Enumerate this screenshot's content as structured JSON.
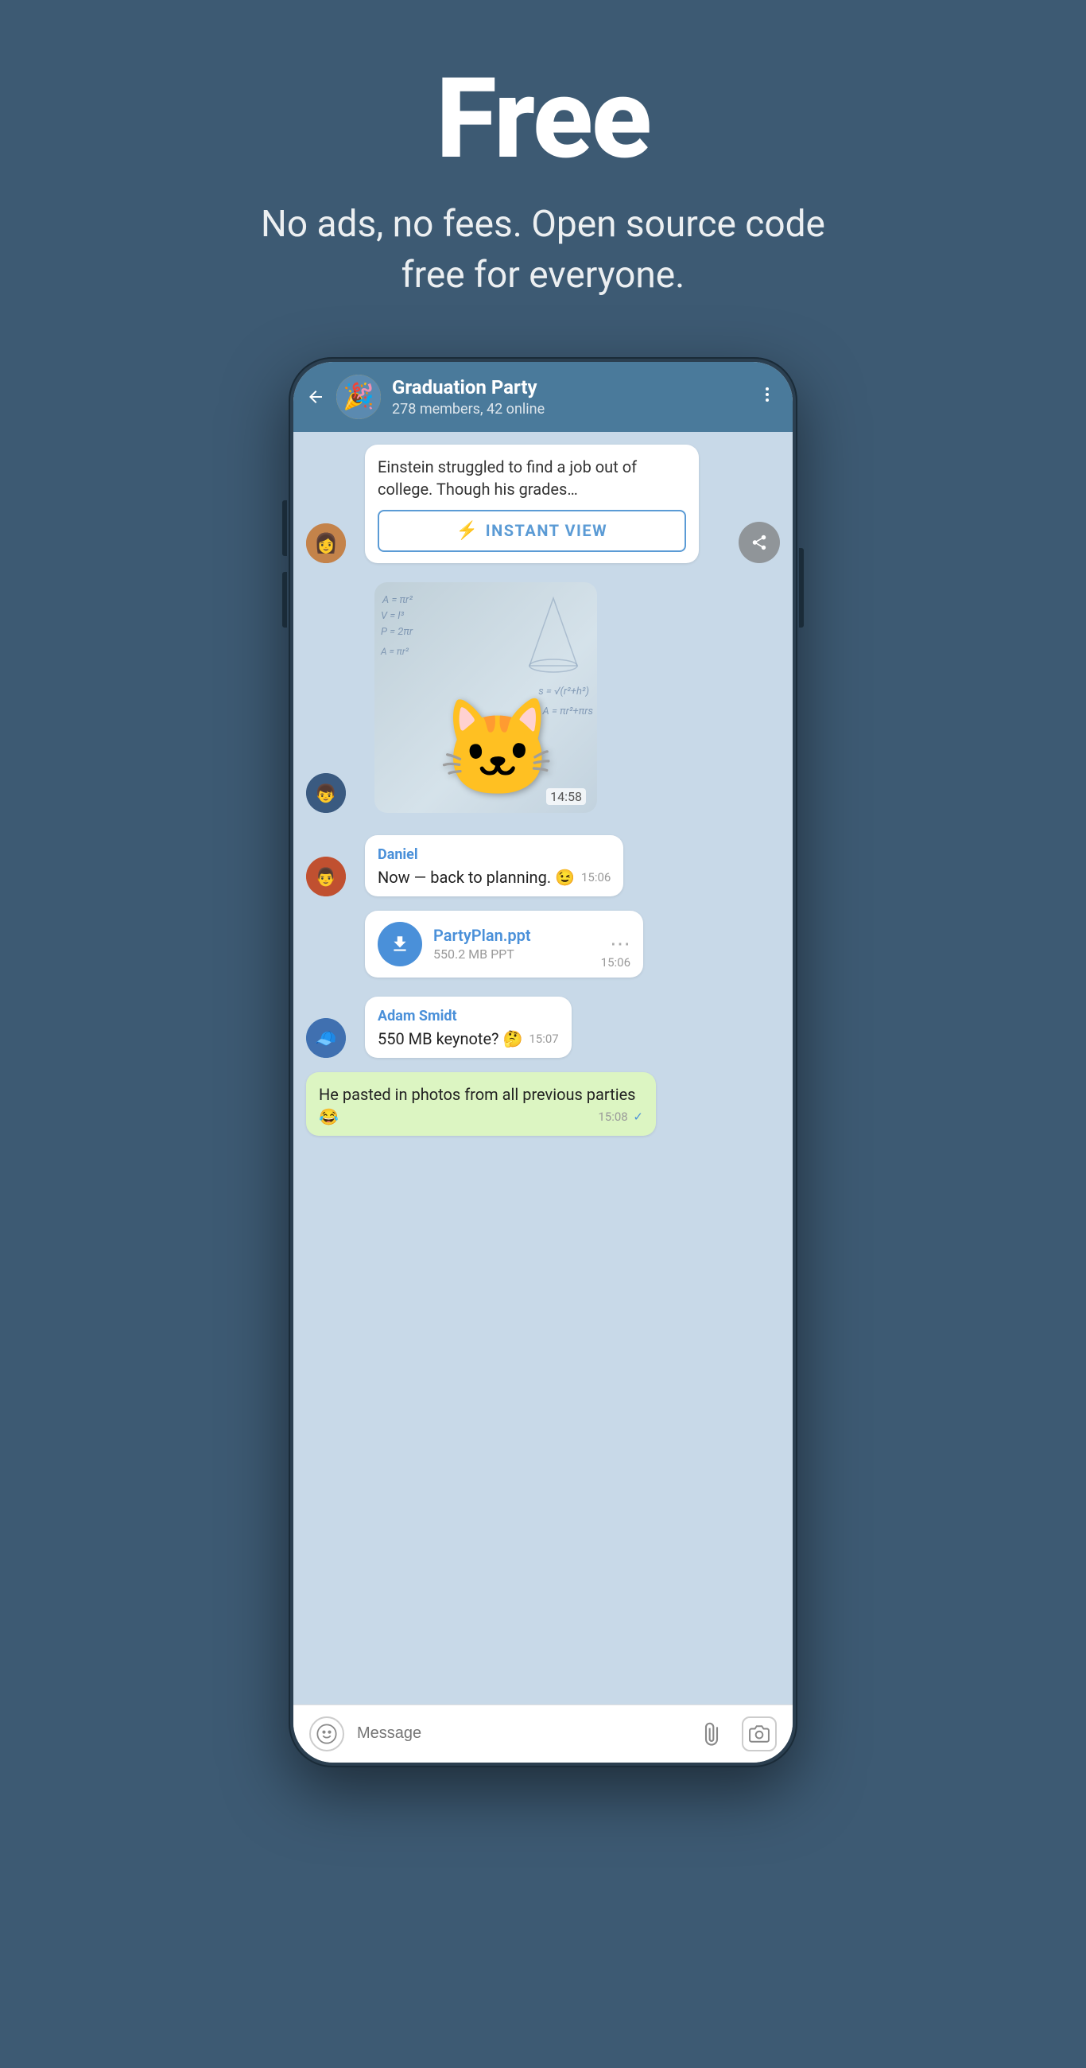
{
  "hero": {
    "title": "Free",
    "subtitle": "No ads, no fees. Open source code free for everyone."
  },
  "phone": {
    "header": {
      "group_name": "Graduation Party",
      "group_info": "278 members, 42 online",
      "back_label": "←",
      "more_label": "⋮"
    },
    "messages": [
      {
        "type": "article",
        "sender_avatar": "👩",
        "text": "Einstein struggled to find a job out of college. Though his grades…",
        "instant_view_label": "INSTANT VIEW"
      },
      {
        "type": "sticker",
        "sender_avatar": "👦",
        "time": "14:58"
      },
      {
        "type": "received",
        "sender": "Daniel",
        "text": "Now — back to planning. 😉",
        "time": "15:06",
        "sender_avatar": "👨"
      },
      {
        "type": "file",
        "file_name": "PartyPlan.ppt",
        "file_size": "550.2 MB PPT",
        "time": "15:06",
        "sender_avatar": "👨"
      },
      {
        "type": "received",
        "sender": "Adam Smidt",
        "text": "550 MB keynote? 🤔",
        "time": "15:07",
        "sender_avatar": "🧢"
      },
      {
        "type": "sent",
        "text": "He pasted in photos from all previous parties 😂",
        "time": "15:08",
        "check": "✓"
      }
    ],
    "input_bar": {
      "placeholder": "Message",
      "emoji_icon": "☺",
      "attach_icon": "📎",
      "camera_icon": "📷"
    }
  }
}
